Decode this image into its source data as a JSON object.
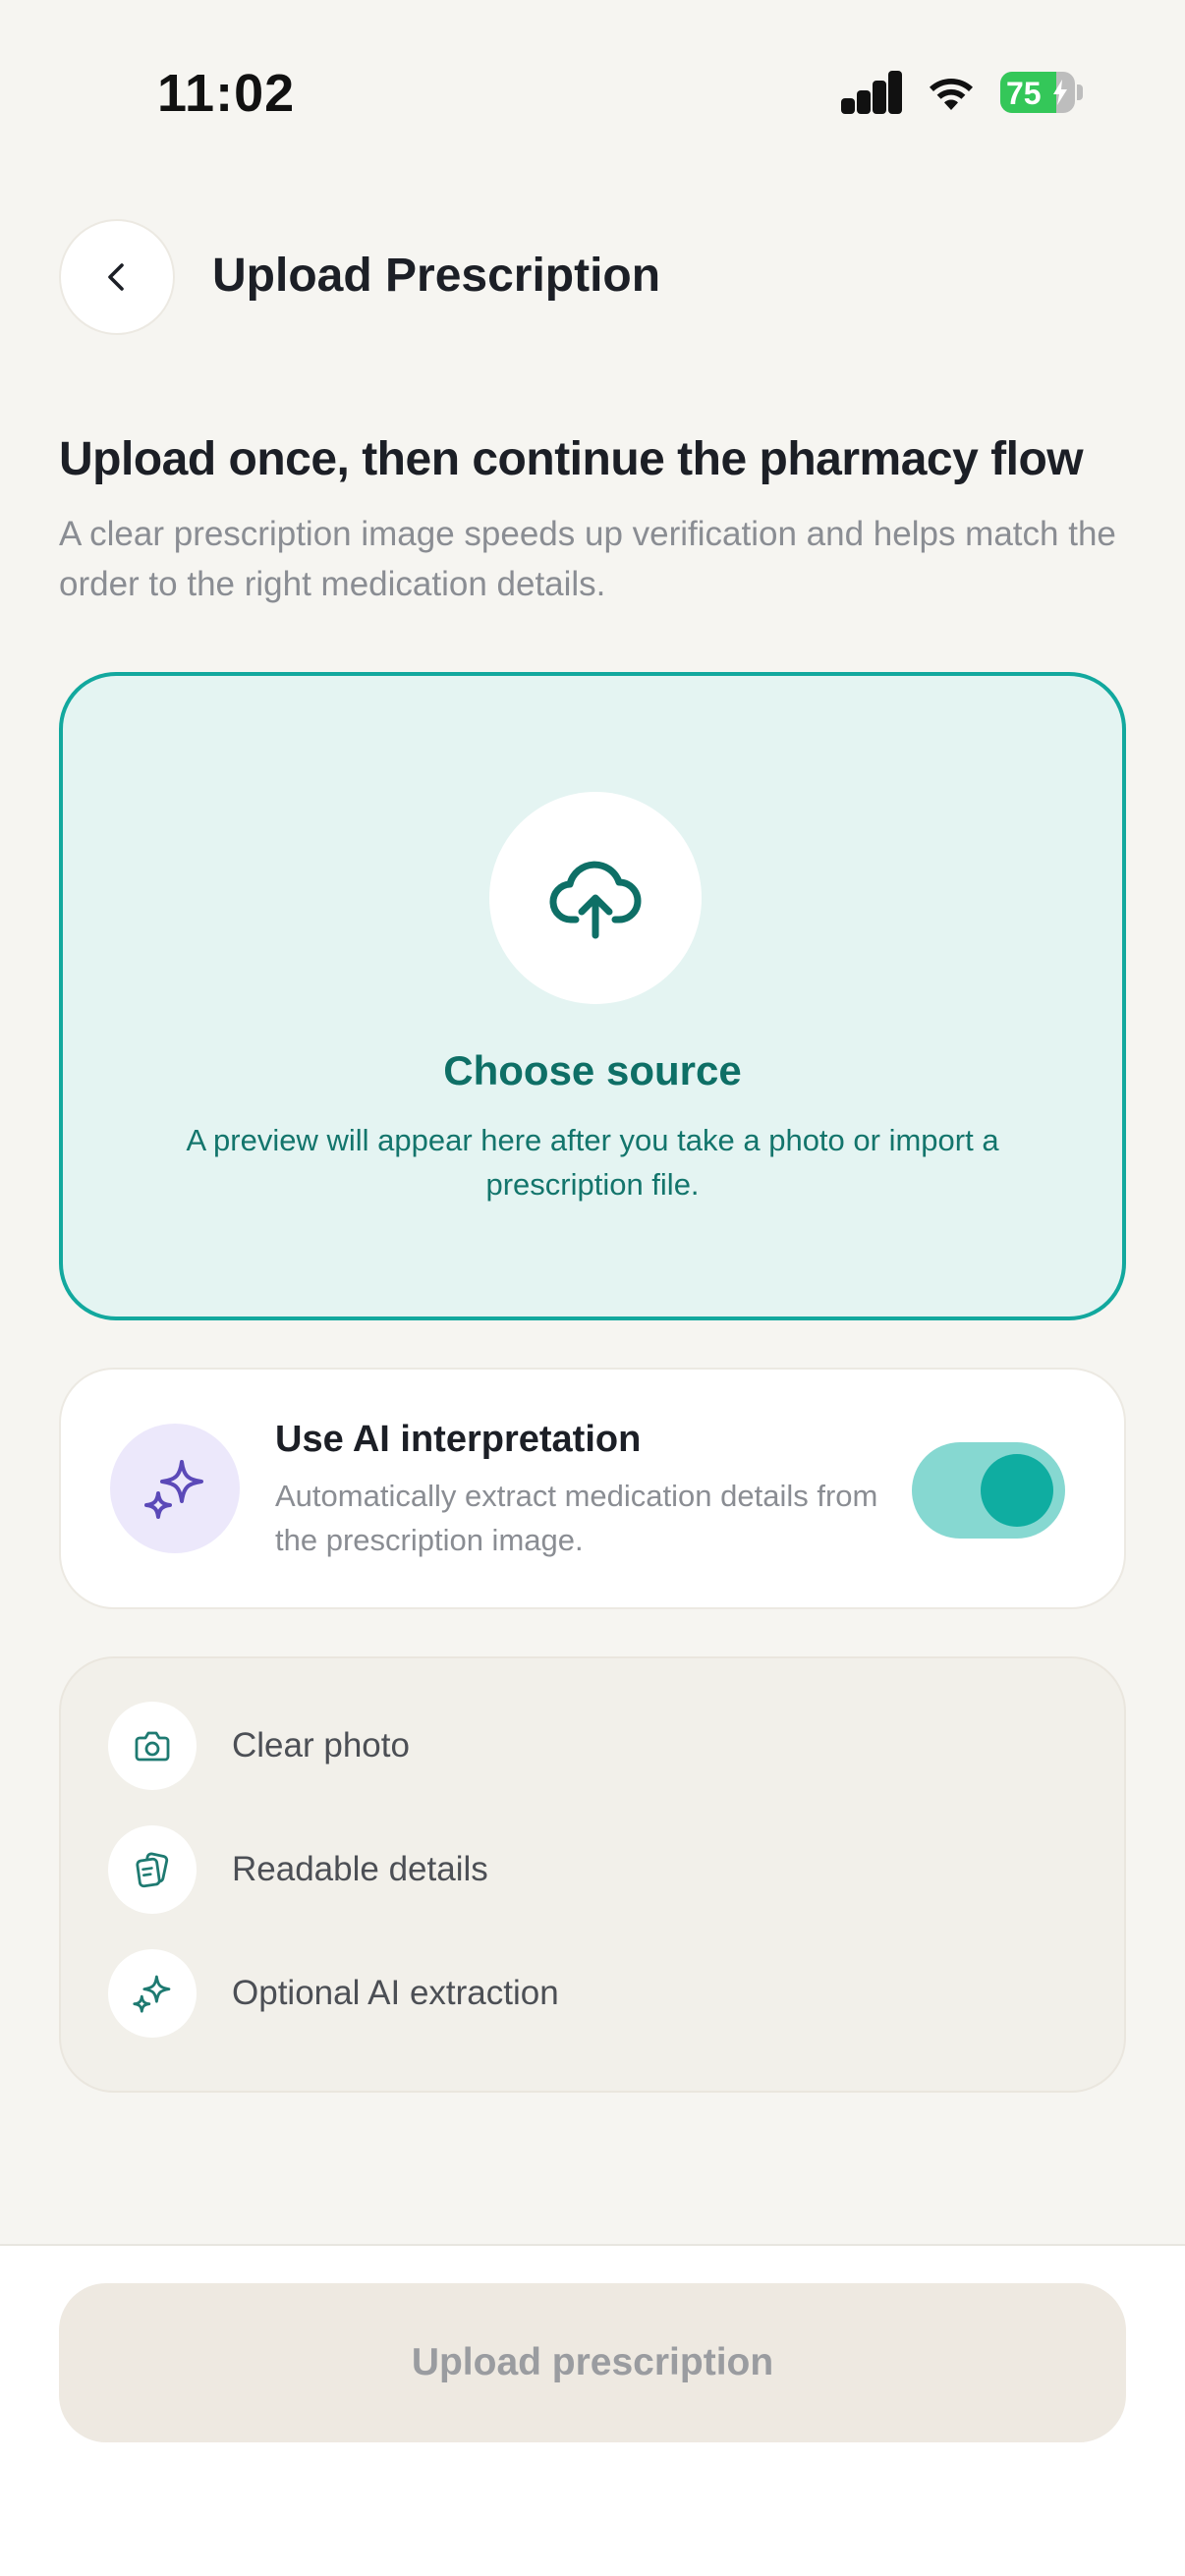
{
  "status_bar": {
    "time": "11:02",
    "battery_percent": "75",
    "battery_level": 0.75,
    "icons": [
      "signal-icon",
      "wifi-icon",
      "battery-charging-icon"
    ]
  },
  "header": {
    "back_icon": "chevron-left-icon",
    "title": "Upload Prescription"
  },
  "intro": {
    "headline": "Upload once, then continue the pharmacy flow",
    "subtext": "A clear prescription image speeds up verification and helps match the order to the right medication details."
  },
  "upload_area": {
    "icon": "cloud-upload-icon",
    "title": "Choose source",
    "description": "A preview will appear here after you take a photo or import a prescription file."
  },
  "ai_option": {
    "icon": "sparkles-icon",
    "title": "Use AI interpretation",
    "description": "Automatically extract medication details from the prescription image.",
    "enabled": true
  },
  "tips": [
    {
      "icon": "camera-icon",
      "label": "Clear photo"
    },
    {
      "icon": "document-icon",
      "label": "Readable details"
    },
    {
      "icon": "sparkles-icon",
      "label": "Optional AI extraction"
    }
  ],
  "footer": {
    "upload_button_label": "Upload prescription",
    "upload_button_disabled": true
  },
  "colors": {
    "background": "#F6F5F1",
    "accent_teal": "#12A89E",
    "accent_teal_dark": "#0E6F66",
    "ai_purple": "#5B49B8",
    "disabled_button": "#EEE9E1"
  }
}
